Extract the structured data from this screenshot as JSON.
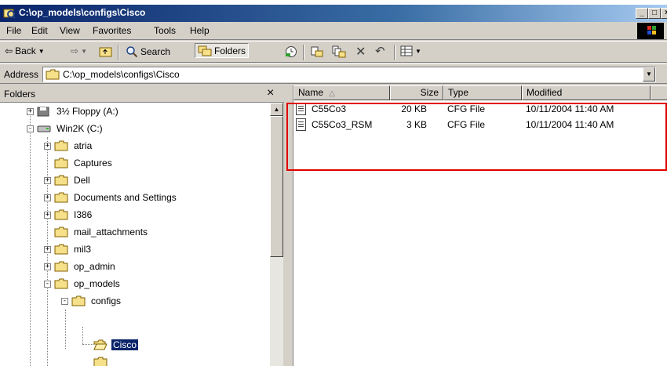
{
  "window": {
    "title": "C:\\op_models\\configs\\Cisco"
  },
  "menu": [
    "File",
    "Edit",
    "View",
    "Favorites",
    "Tools",
    "Help"
  ],
  "toolbar": {
    "back": "Back",
    "search": "Search",
    "folders": "Folders"
  },
  "address": {
    "label": "Address",
    "value": "C:\\op_models\\configs\\Cisco"
  },
  "folders_pane": {
    "title": "Folders",
    "close": "×",
    "tree": [
      {
        "label": "3½ Floppy (A:)",
        "expander": "+",
        "icon": "floppy-icon"
      },
      {
        "label": "Win2K (C:)",
        "expander": "-",
        "icon": "drive-icon"
      },
      {
        "label": "atria",
        "expander": "+",
        "icon": "folder-icon"
      },
      {
        "label": "Captures",
        "expander": "",
        "icon": "folder-icon"
      },
      {
        "label": "Dell",
        "expander": "+",
        "icon": "folder-icon"
      },
      {
        "label": "Documents and Settings",
        "expander": "+",
        "icon": "folder-icon"
      },
      {
        "label": "I386",
        "expander": "+",
        "icon": "folder-icon"
      },
      {
        "label": "mail_attachments",
        "expander": "",
        "icon": "folder-icon"
      },
      {
        "label": "mil3",
        "expander": "+",
        "icon": "folder-icon"
      },
      {
        "label": "op_admin",
        "expander": "+",
        "icon": "folder-icon"
      },
      {
        "label": "op_models",
        "expander": "-",
        "icon": "folder-icon"
      },
      {
        "label": "configs",
        "expander": "-",
        "icon": "folder-icon"
      },
      {
        "label": "Cisco",
        "expander": "",
        "icon": "open-folder-icon",
        "selected": true
      }
    ]
  },
  "files_pane": {
    "columns": [
      "Name",
      "Size",
      "Type",
      "Modified"
    ],
    "sort_indicator": "△",
    "rows": [
      {
        "name": "C55Co3",
        "size": "20 KB",
        "type": "CFG File",
        "modified": "10/11/2004 11:40 AM"
      },
      {
        "name": "C55Co3_RSM",
        "size": "3 KB",
        "type": "CFG File",
        "modified": "10/11/2004 11:40 AM"
      }
    ]
  },
  "colors": {
    "title_gradient_start": "#0a246a",
    "title_gradient_end": "#a6caf0",
    "selection": "#0a246a",
    "highlight_box": "#e00000",
    "folder": "#f6e08a"
  }
}
